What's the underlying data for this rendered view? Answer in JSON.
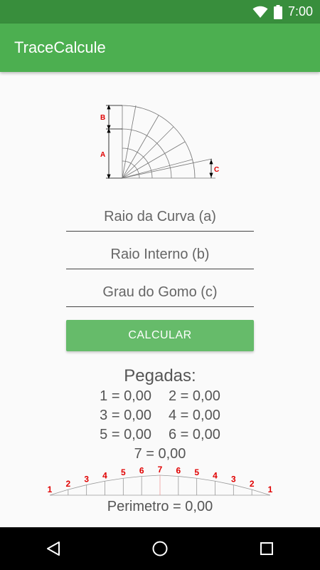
{
  "status_bar": {
    "time": "7:00",
    "icons": [
      "wifi-icon",
      "battery-icon"
    ]
  },
  "app_bar": {
    "title": "TraceCalcule",
    "color": "#4caf50"
  },
  "diagram": {
    "labels": {
      "a": "A",
      "b": "B",
      "c": "C"
    },
    "label_color": "#e00000"
  },
  "form": {
    "raio_curva_placeholder": "Raio da Curva (a)",
    "raio_interno_placeholder": "Raio Interno (b)",
    "grau_gomo_placeholder": "Grau do Gomo (c)",
    "calc_button": "CALCULAR",
    "button_color": "#66bb6a"
  },
  "results": {
    "title": "Pegadas:",
    "p1": "1 = 0,00",
    "p2": "2 = 0,00",
    "p3": "3 = 0,00",
    "p4": "4 = 0,00",
    "p5": "5 = 0,00",
    "p6": "6 = 0,00",
    "p7": "7 = 0,00",
    "perimetro": "Perimetro = 0,00"
  },
  "ruler": {
    "labels": [
      "1",
      "2",
      "3",
      "4",
      "5",
      "6",
      "7",
      "6",
      "5",
      "4",
      "3",
      "2",
      "1"
    ]
  },
  "nav_bar": {
    "icons": [
      "back-icon",
      "home-icon",
      "recents-icon"
    ]
  }
}
